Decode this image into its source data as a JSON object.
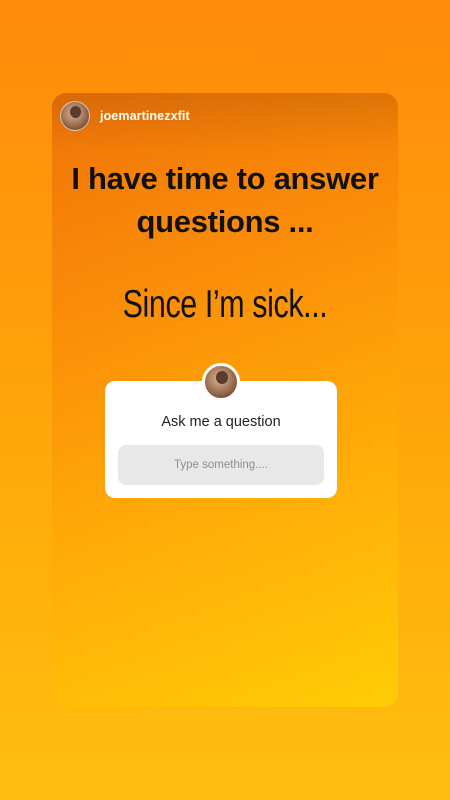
{
  "story": {
    "username": "joemartinezxfit",
    "headline_line1": "I have time to answer",
    "headline_line2": "questions ...",
    "subline": "Since I’m sick...",
    "avatar_icon": "profile-photo"
  },
  "question_sticker": {
    "prompt": "Ask me a question",
    "placeholder": "Type something....",
    "avatar_icon": "profile-photo"
  },
  "colors": {
    "background_top": "#ff8c0a",
    "background_bottom": "#ffbf10",
    "card_top": "#f07408",
    "card_bottom": "#ffcc06",
    "text": "#111111",
    "sticker_bg": "#ffffff",
    "field_bg": "#e8e8e8"
  }
}
